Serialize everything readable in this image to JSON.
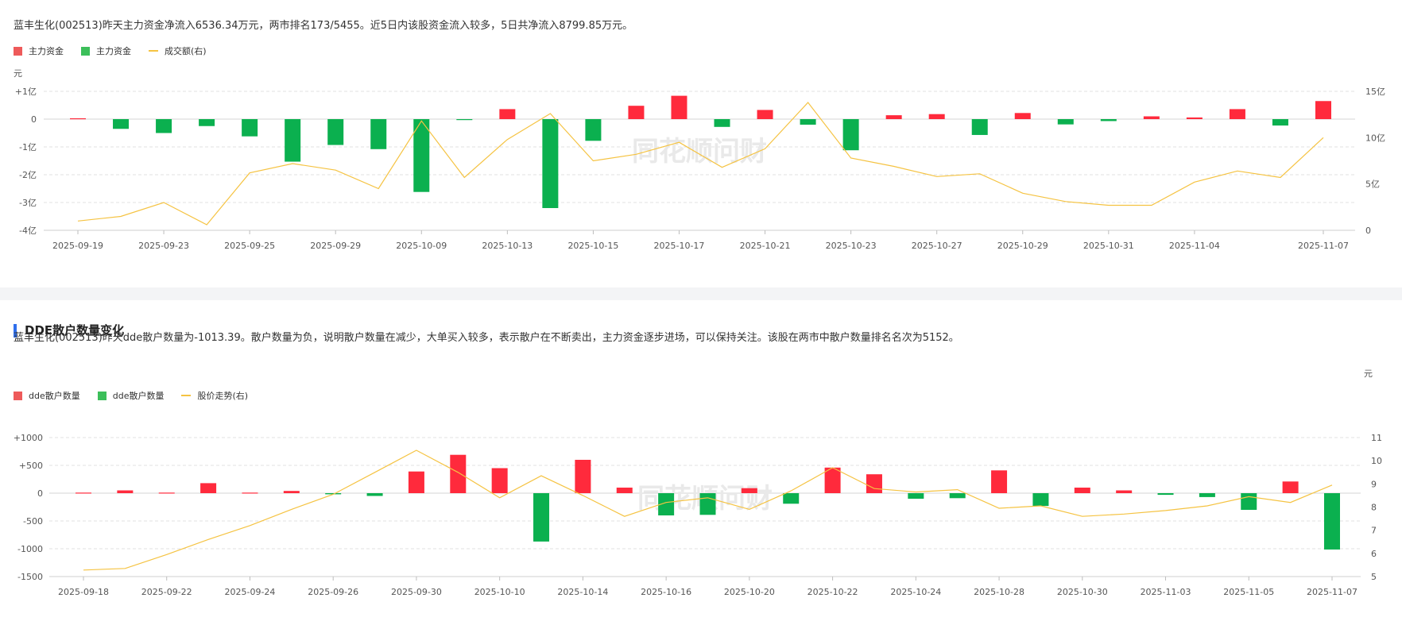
{
  "colors": {
    "up": "#ff2a3c",
    "down": "#0bb04f",
    "line": "#f5c342",
    "legend_up": "#ee5a5a",
    "legend_down": "#3cbf5a",
    "grid": "#e1e1e1",
    "axis_text": "#555555",
    "watermark": "#e9e9e9",
    "accent": "#2f6fed"
  },
  "fund_panel": {
    "summary": "蓝丰生化(002513)昨天主力资金净流入6536.34万元，两市排名173/5455。近5日内该股资金流入较多，5日共净流入8799.85万元。",
    "legend": [
      "主力资金",
      "主力资金",
      "成交额(右)"
    ],
    "chart_data": {
      "type": "bar",
      "unit_left": "元",
      "left_ticks": [
        "+1亿",
        "0",
        "-1亿",
        "-2亿",
        "-3亿",
        "-4亿"
      ],
      "right_ticks": [
        "15亿",
        "10亿",
        "5亿",
        "0"
      ],
      "ylim_left": [
        -4,
        1
      ],
      "ylim_right": [
        0,
        15
      ],
      "x_ticks": [
        "2025-09-19",
        "2025-09-23",
        "2025-09-25",
        "2025-09-29",
        "2025-10-09",
        "2025-10-13",
        "2025-10-15",
        "2025-10-17",
        "2025-10-21",
        "2025-10-23",
        "2025-10-27",
        "2025-10-29",
        "2025-10-31",
        "2025-11-04",
        "2025-11-07"
      ],
      "series": [
        {
          "name": "主力资金",
          "type": "bar",
          "values": [
            0.03,
            -0.35,
            -0.5,
            -0.25,
            -0.62,
            -1.53,
            -0.93,
            -1.08,
            -2.62,
            -0.03,
            0.36,
            -3.2,
            -0.78,
            0.48,
            0.84,
            -0.28,
            0.33,
            -0.2,
            -1.12,
            0.14,
            0.18,
            -0.57,
            0.22,
            -0.19,
            -0.07,
            0.1,
            0.06,
            0.36,
            -0.23,
            0.65
          ]
        },
        {
          "name": "成交额(右)",
          "type": "line",
          "values": [
            1.0,
            1.5,
            3.0,
            0.6,
            6.2,
            7.2,
            6.5,
            4.5,
            11.8,
            5.7,
            9.8,
            12.6,
            7.5,
            8.2,
            9.5,
            6.8,
            8.8,
            13.8,
            7.8,
            6.9,
            5.8,
            6.1,
            4.0,
            3.1,
            2.7,
            2.7,
            5.2,
            6.4,
            5.7,
            10.0
          ]
        }
      ]
    },
    "watermark": "同花顺问财"
  },
  "dde_panel": {
    "title": "DDE散户数量变化",
    "summary": "蓝丰生化(002513)昨天dde散户数量为-1013.39。散户数量为负，说明散户数量在减少，大单买入较多，表示散户在不断卖出，主力资金逐步进场，可以保持关注。该股在两市中散户数量排名名次为5152。",
    "legend": [
      "dde散户数量",
      "dde散户数量",
      "股价走势(右)"
    ],
    "chart_data": {
      "type": "bar",
      "unit_right": "元",
      "left_ticks": [
        "+1000",
        "+500",
        "0",
        "-500",
        "-1000",
        "-1500"
      ],
      "right_ticks": [
        "11",
        "10",
        "9",
        "8",
        "7",
        "6",
        "5"
      ],
      "ylim_left": [
        -1500,
        1000
      ],
      "ylim_right": [
        5,
        11
      ],
      "x_ticks": [
        "2025-09-18",
        "2025-09-22",
        "2025-09-24",
        "2025-09-26",
        "2025-09-30",
        "2025-10-10",
        "2025-10-14",
        "2025-10-16",
        "2025-10-20",
        "2025-10-22",
        "2025-10-24",
        "2025-10-28",
        "2025-10-30",
        "2025-11-03",
        "2025-11-05",
        "2025-11-07"
      ],
      "series": [
        {
          "name": "dde散户数量",
          "type": "bar",
          "values": [
            10,
            50,
            10,
            180,
            10,
            40,
            -20,
            -50,
            390,
            690,
            450,
            -870,
            600,
            100,
            -400,
            -390,
            90,
            -190,
            460,
            340,
            -100,
            -90,
            410,
            -230,
            100,
            50,
            -30,
            -70,
            -300,
            210,
            -1013.39
          ]
        },
        {
          "name": "股价走势(右)",
          "type": "line",
          "values": [
            5.28,
            5.35,
            5.95,
            6.6,
            7.2,
            7.9,
            8.55,
            9.5,
            10.45,
            9.5,
            8.4,
            9.35,
            8.5,
            7.6,
            8.2,
            8.4,
            7.9,
            8.7,
            9.7,
            8.8,
            8.65,
            8.75,
            7.95,
            8.05,
            7.6,
            7.7,
            7.85,
            8.05,
            8.45,
            8.2,
            8.95
          ]
        }
      ]
    },
    "watermark": "同花顺问财"
  }
}
